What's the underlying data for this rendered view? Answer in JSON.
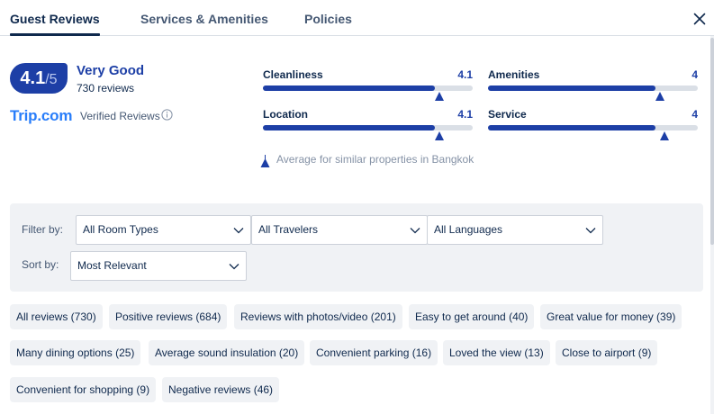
{
  "tabs": [
    {
      "label": "Guest Reviews",
      "active": true
    },
    {
      "label": "Services & Amenities",
      "active": false
    },
    {
      "label": "Policies",
      "active": false
    }
  ],
  "summary": {
    "score": "4.1",
    "score_max": "/5",
    "rating_label": "Very Good",
    "review_count": "730 reviews",
    "source_logo_text": "Trip.com",
    "source_label": "Verified Reviews"
  },
  "categories": [
    {
      "name": "Cleanliness",
      "score": "4.1",
      "fill_fraction": 0.82,
      "average_fraction": 0.84
    },
    {
      "name": "Amenities",
      "score": "4",
      "fill_fraction": 0.8,
      "average_fraction": 0.82
    },
    {
      "name": "Location",
      "score": "4.1",
      "fill_fraction": 0.82,
      "average_fraction": 0.84
    },
    {
      "name": "Service",
      "score": "4",
      "fill_fraction": 0.8,
      "average_fraction": 0.84
    }
  ],
  "average_legend": "Average for similar properties in Bangkok",
  "filters": {
    "filter_label": "Filter by:",
    "sort_label": "Sort by:",
    "room_types": "All Room Types",
    "travelers": "All Travelers",
    "languages": "All Languages",
    "sort": "Most Relevant"
  },
  "chips": [
    "All reviews (730)",
    "Positive reviews (684)",
    "Reviews with photos/video (201)",
    "Easy to get around (40)",
    "Great value for money (39)",
    "Many dining options (25)",
    "Average sound insulation (20)",
    "Convenient parking (16)",
    "Loved the view (13)",
    "Close to airport (9)",
    "Convenient for shopping (9)",
    "Negative reviews (46)"
  ],
  "colors": {
    "brand_blue": "#1d3fa6",
    "logo_blue": "#287dfa",
    "text_dark": "#0f294d",
    "panel_bg": "#f0f2f5"
  },
  "icons": {
    "close": "close-icon",
    "info": "info-icon",
    "chevron": "chevron-down-icon",
    "average_marker": "triangle-marker-icon"
  }
}
